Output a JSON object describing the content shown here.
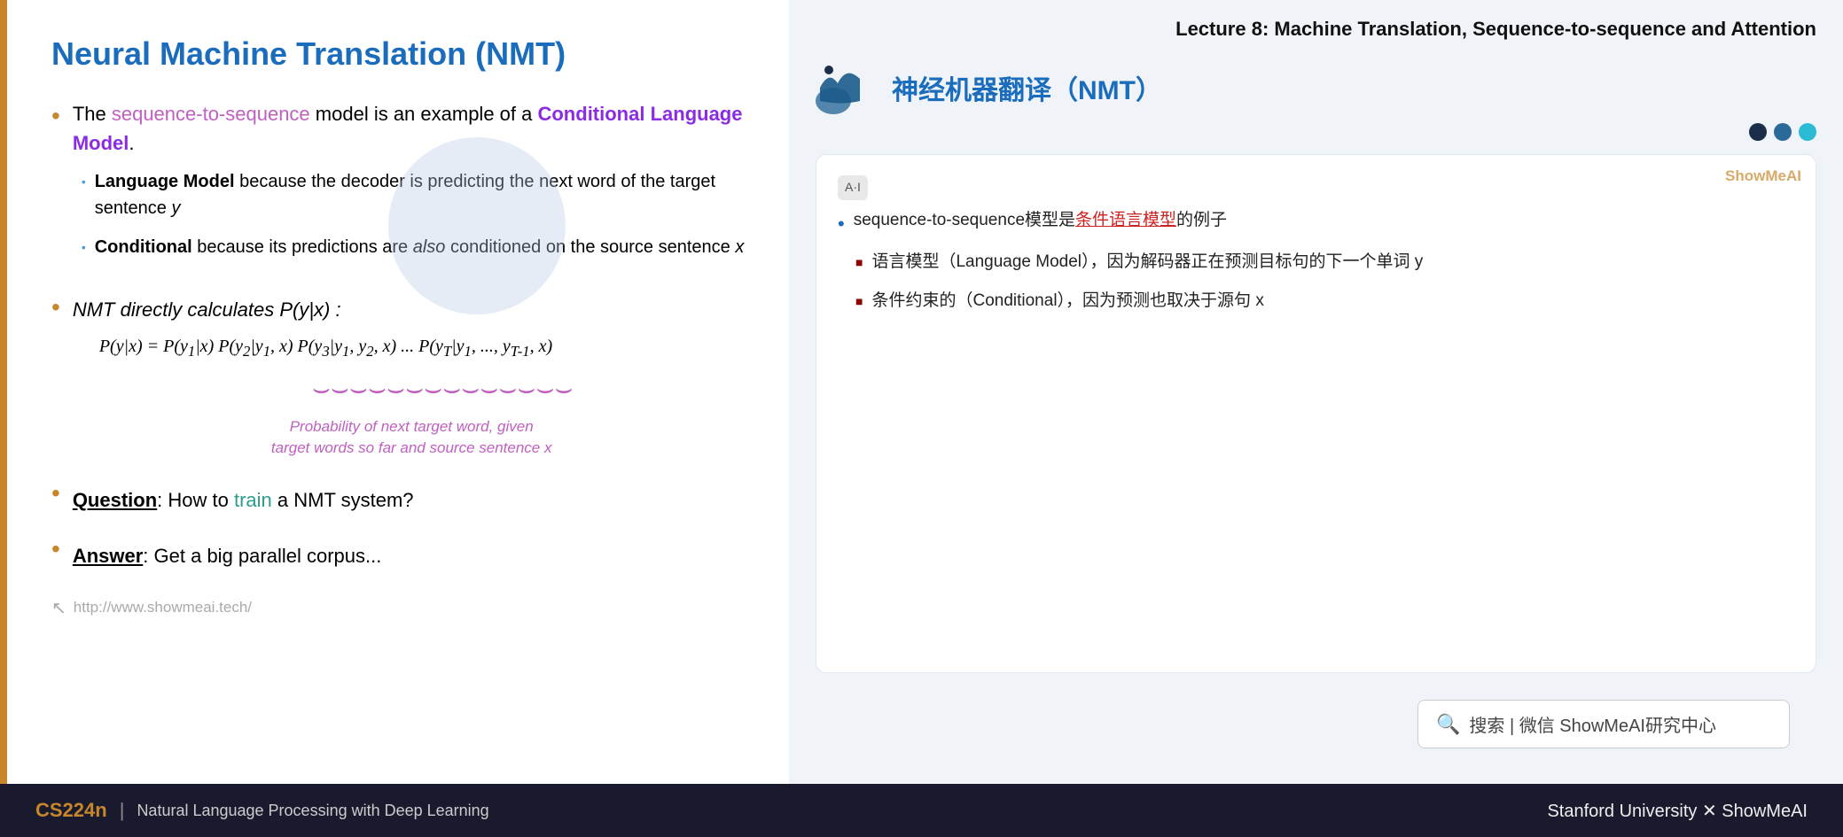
{
  "header": {
    "lecture": "Lecture 8:  Machine Translation, Sequence-to-sequence and Attention"
  },
  "left": {
    "title": "Neural Machine Translation (NMT)",
    "bullet1_prefix": "The ",
    "bullet1_link": "sequence-to-sequence",
    "bullet1_mid": " model is an example of a ",
    "bullet1_bold": "Conditional Language Model",
    "bullet1_end": ".",
    "subbullet1_bold": "Language Model",
    "subbullet1_rest": " because the decoder is predicting the next word of the target sentence ",
    "subbullet1_italic": "y",
    "subbullet2_bold": "Conditional",
    "subbullet2_rest1": " because its predictions are ",
    "subbullet2_italic": "also",
    "subbullet2_rest2": " conditioned on the source sentence ",
    "subbullet2_x": "x",
    "bullet2_prefix": "NMT directly calculates ",
    "bullet2_formula_inline": "P(y|x)",
    "bullet2_colon": " :",
    "formula": "P(y|x) = P(y₁|x) P(y₂|y₁, x) P(y₃|y₁, y₂, x) ... P(yT|y₁, ..., yT-1, x)",
    "formula_annotation": "Probability of next target word, given\ntarget words so far and source sentence x",
    "question_bold": "Question",
    "question_rest": ": How to ",
    "question_link": "train",
    "question_end": " a NMT system?",
    "answer_bold": "Answer",
    "answer_rest": ": Get a big parallel corpus...",
    "url": "http://www.showmeai.tech/"
  },
  "right": {
    "nmt_title_cn": "神经机器翻译（NMT）",
    "ai_badge": "A·I",
    "watermark": "ShowMeAI",
    "annotation_main": "sequence-to-sequence模型是条件语言模型的例子",
    "annotation_main_link": "条件语言模型",
    "sub1_text": "语言模型（Language Model），因为解码器正在预测目标句的下一个单词 y",
    "sub2_text": "条件约束的（Conditional），因为预测也取决于源句 x",
    "search_text": "搜索 | 微信 ShowMeAI研究中心"
  },
  "dots": {
    "colors": [
      "#1a2e4a",
      "#2a6a9a",
      "#2abcd4"
    ]
  },
  "footer": {
    "course": "CS224n",
    "divider": "|",
    "description": "Natural Language Processing with Deep Learning",
    "right": "Stanford University  ✕  ShowMeAI"
  }
}
